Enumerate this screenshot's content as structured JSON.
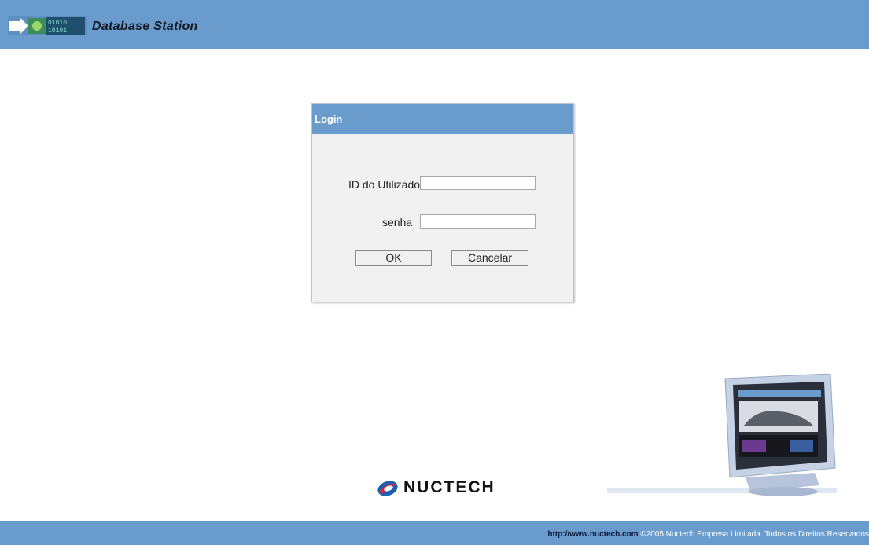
{
  "header": {
    "app_title": "Database Station"
  },
  "login": {
    "title": "Login",
    "user_label": "ID do Utilizador",
    "user_value": "",
    "password_label": "senha",
    "password_value": "",
    "ok_label": "OK",
    "cancel_label": "Cancelar"
  },
  "brand": {
    "name": "NUCTECH"
  },
  "footer": {
    "link": "http://www.nuctech.com",
    "copyright": "©2005,Nuctech Empresa Limitada. Todos os Direitos Reservados"
  },
  "colors": {
    "header_bg": "#6a9bcd",
    "panel_bg": "#f1f1f1",
    "brand_red": "#d3282f",
    "brand_blue": "#1b5fb0"
  },
  "icons": {
    "logo": "database-station-logo",
    "brand": "nuctech-logo-mark",
    "illustration": "monitor-illustration"
  }
}
